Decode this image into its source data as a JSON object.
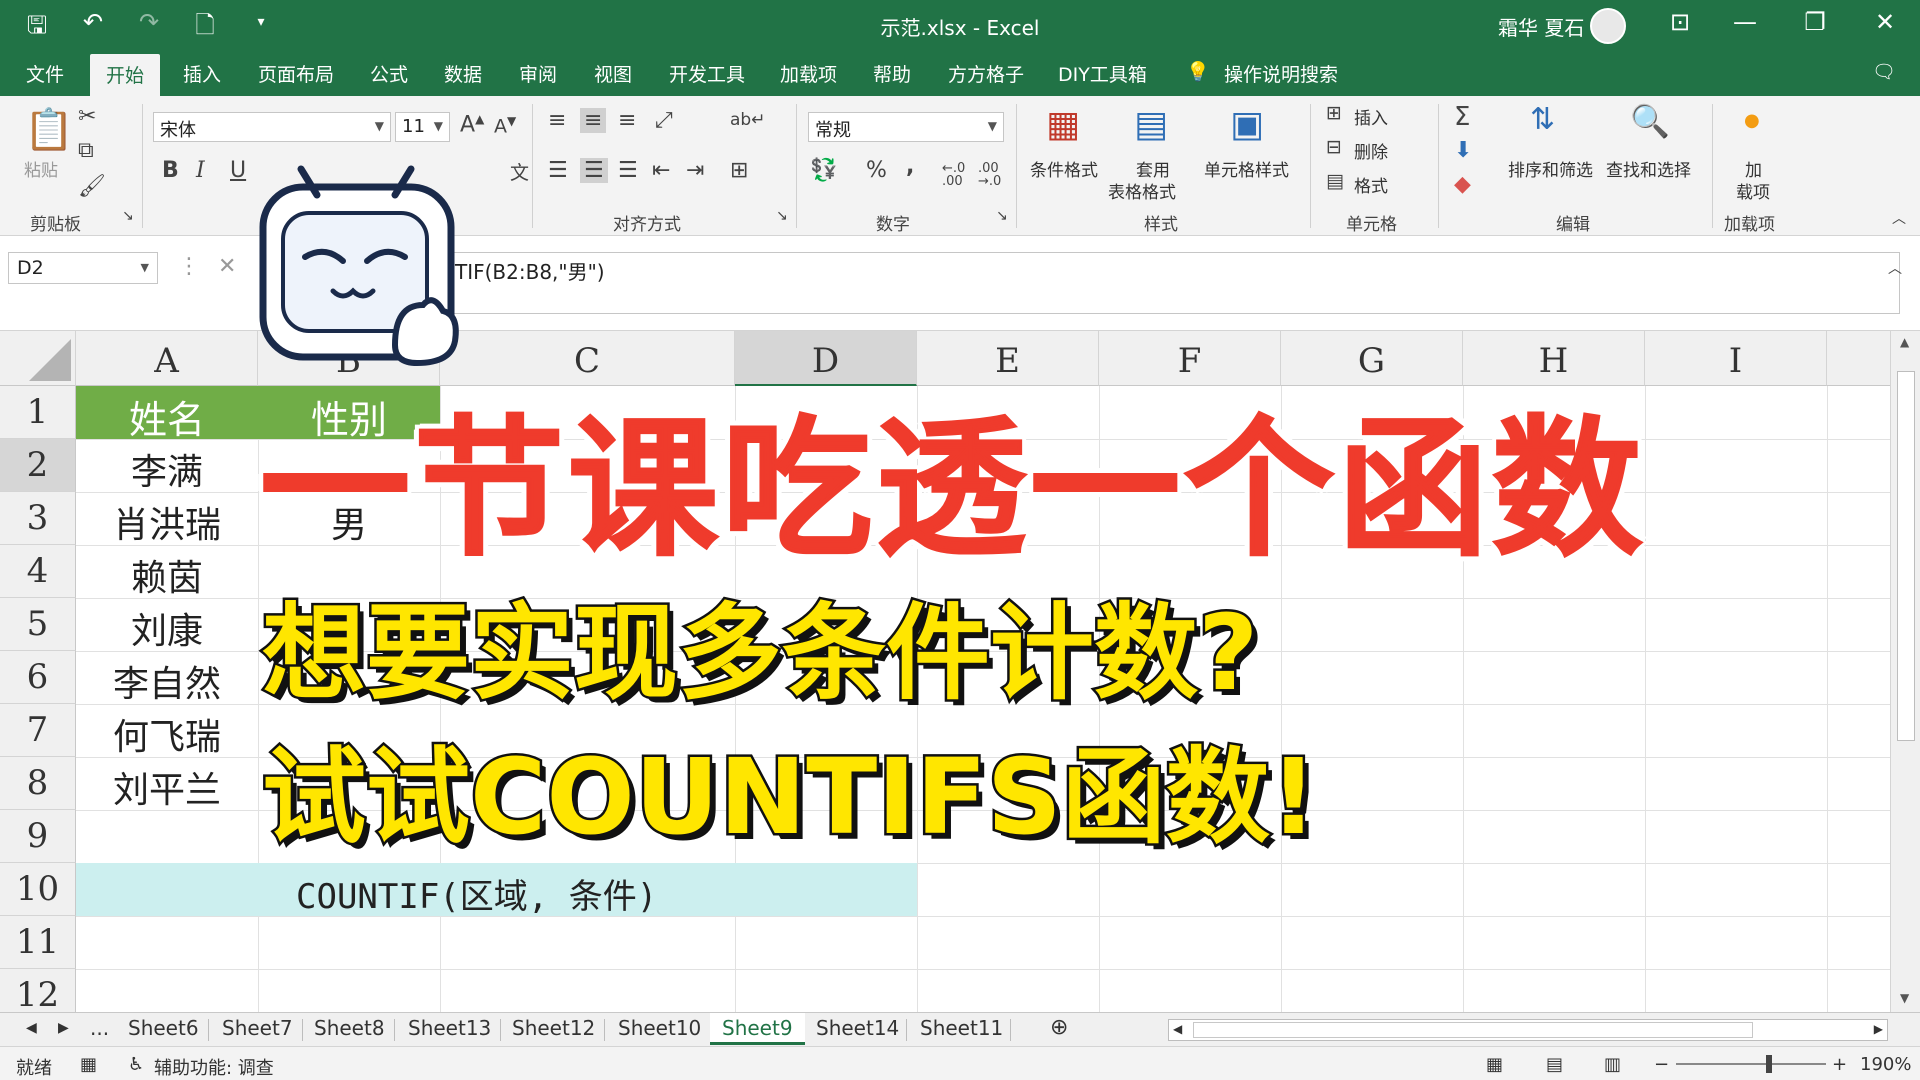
{
  "window": {
    "title": "示范.xlsx  -  Excel",
    "user": "霜华 夏石",
    "controls": [
      "⊡",
      "—",
      "❐",
      "✕"
    ]
  },
  "tabs": [
    "文件",
    "开始",
    "插入",
    "页面布局",
    "公式",
    "数据",
    "审阅",
    "视图",
    "开发工具",
    "加载项",
    "帮助",
    "方方格子",
    "DIY工具箱",
    "操作说明搜索"
  ],
  "ribbon": {
    "groups": {
      "clipboard": "剪贴板",
      "align": "对齐方式",
      "number": "数字",
      "styles": "样式",
      "cells": "单元格",
      "editing": "编辑",
      "addins": "加载项"
    },
    "paste": "粘贴",
    "font_name": "宋体",
    "font_size": "11",
    "bold": "B",
    "italic": "I",
    "underline": "U",
    "number_format": "常规",
    "percent": "%",
    "comma": ",",
    "cond_format": "条件格式",
    "table_format_1": "套用",
    "table_format_2": "表格格式",
    "cell_style": "单元格样式",
    "insert": "插入",
    "delete": "删除",
    "format": "格式",
    "sort_filter": "排序和筛选",
    "find_select": "查找和选择",
    "addin_1": "加",
    "addin_2": "载项"
  },
  "formula_bar": {
    "name_box": "D2",
    "formula": "TIF(B2:B8,\"男\")"
  },
  "columns": [
    "A",
    "B",
    "C",
    "D",
    "E",
    "F",
    "G",
    "H",
    "I"
  ],
  "rows": [
    "1",
    "2",
    "3",
    "4",
    "5",
    "6",
    "7",
    "8",
    "9",
    "10",
    "11",
    "12"
  ],
  "table": {
    "header_name": "姓名",
    "header_gender": "性别",
    "names": [
      "李满",
      "肖洪瑞",
      "赖茵",
      "刘康",
      "李自然",
      "何飞瑞",
      "刘平兰"
    ],
    "visible_gender": "男"
  },
  "note": "COUNTIF(区域, 条件)",
  "sheets": [
    "Sheet6",
    "Sheet7",
    "Sheet8",
    "Sheet13",
    "Sheet12",
    "Sheet10",
    "Sheet9",
    "Sheet14",
    "Sheet11"
  ],
  "active_sheet": "Sheet9",
  "status": {
    "ready": "就绪",
    "accessibility": "辅助功能: 调查",
    "zoom": "190%"
  },
  "overlay": {
    "headline": "一节课吃透一个函数",
    "line1": "想要实现多条件计数?",
    "line2": "试试COUNTIFS函数!"
  },
  "colors": {
    "excel_green": "#217346",
    "header_fill": "#70ad47",
    "teal_fill": "#ccefef",
    "headline_red": "#ef3b2c",
    "sub_yellow": "#ffe600"
  }
}
